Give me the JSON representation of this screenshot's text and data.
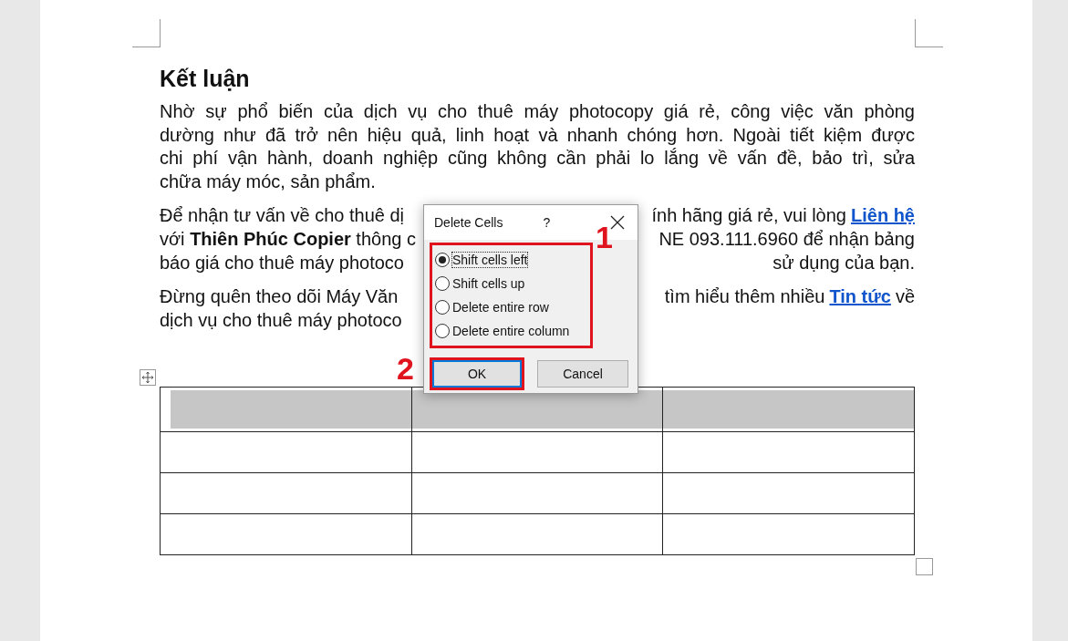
{
  "document": {
    "heading": "Kết luận",
    "paragraphs": [
      {
        "kind": "full",
        "lines": [
          "Nhờ sự phổ biến của dịch vụ cho thuê máy photocopy giá rẻ, công việc văn phòng",
          "dường như đã trở nên hiệu quả, linh hoạt và nhanh chóng hơn. Ngoài tiết kiệm được",
          "chi phí vận hành, doanh nghiệp cũng không cần phải lo lắng về vấn đề, bảo trì, sửa",
          "chữa máy móc, sản phẩm."
        ]
      },
      {
        "kind": "partial",
        "lines": [
          {
            "left": [
              {
                "kind": "text",
                "text": "Để nhận tư vấn về cho thuê dị"
              }
            ],
            "right": [
              {
                "kind": "text",
                "text": "ính hãng giá rẻ, vui lòng"
              },
              {
                "kind": "link",
                "text": "Liên hệ"
              }
            ]
          },
          {
            "left": [
              {
                "kind": "text",
                "text": "với **Thiên Phúc Copier** thông c"
              }
            ],
            "right": [
              {
                "kind": "text",
                "text": "NE 093.111.6960 để nhận bảng"
              }
            ]
          },
          {
            "left": [
              {
                "kind": "text",
                "text": "báo giá cho thuê máy photoco"
              }
            ],
            "right": [
              {
                "kind": "text",
                "text": "sử dụng của bạn."
              }
            ]
          }
        ]
      },
      {
        "kind": "partial",
        "lines": [
          {
            "left": [
              {
                "kind": "text",
                "text": "Đừng quên theo dõi Máy Văn"
              }
            ],
            "right": [
              {
                "kind": "text",
                "text": "tìm hiểu thêm nhiều"
              },
              {
                "kind": "link",
                "text": "Tin tức"
              },
              {
                "kind": "text",
                "text": "về"
              }
            ]
          },
          {
            "left": [
              {
                "kind": "text",
                "text": "dịch vụ cho thuê máy photoco"
              }
            ]
          }
        ]
      }
    ],
    "table": {
      "rows": [
        {
          "cells": [
            {
              "shaded": true
            },
            {
              "shaded": true
            },
            {
              "shaded": true
            }
          ]
        },
        {
          "cells": [
            {
              "shaded": false
            },
            {
              "shaded": false
            },
            {
              "shaded": false
            }
          ]
        },
        {
          "cells": [
            {
              "shaded": false
            },
            {
              "shaded": false
            },
            {
              "shaded": false
            }
          ]
        },
        {
          "cells": [
            {
              "shaded": false
            },
            {
              "shaded": false
            },
            {
              "shaded": false
            }
          ]
        }
      ]
    }
  },
  "dialog": {
    "title": "Delete Cells",
    "help": "?",
    "options_callout": "1",
    "options": [
      {
        "label": "Shift cells left",
        "selected": true
      },
      {
        "label": "Shift cells up",
        "selected": false
      },
      {
        "label": "Delete entire row",
        "selected": false
      },
      {
        "label": "Delete entire column",
        "selected": false
      }
    ],
    "buttons": [
      {
        "label": "OK",
        "default": true,
        "callout": "2"
      },
      {
        "label": "Cancel",
        "default": false
      }
    ]
  }
}
